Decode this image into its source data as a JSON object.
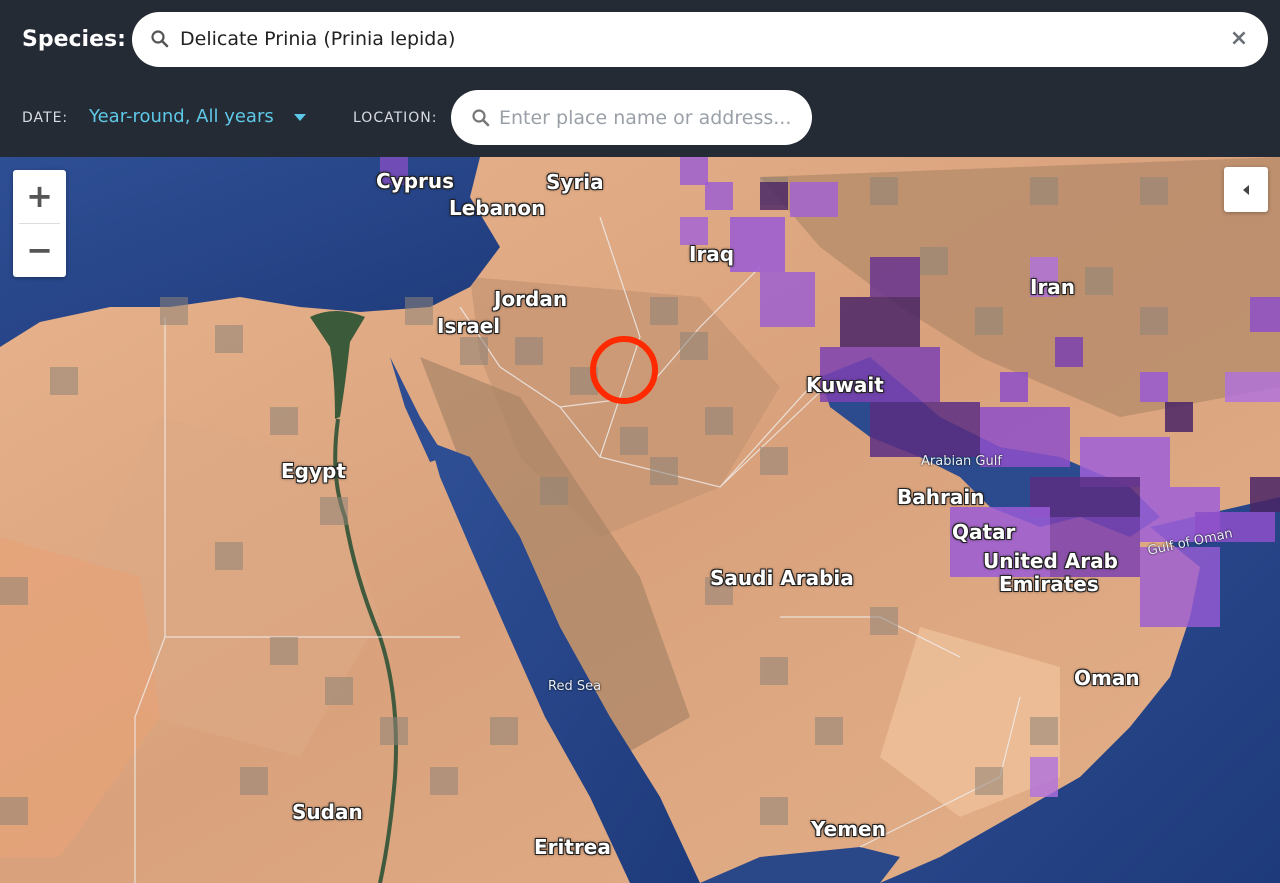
{
  "header": {
    "species_label": "Species:",
    "species_value": "Delicate Prinia (Prinia lepida)",
    "clear_glyph": "×",
    "date_label": "DATE:",
    "date_value": "Year-round,  All years",
    "location_label": "LOCATION:",
    "location_placeholder": "Enter place name or address..."
  },
  "map_controls": {
    "zoom_in": "+",
    "zoom_out": "−",
    "panel_toggle_icon": "chevron-left-icon"
  },
  "map_labels": {
    "cyprus": "Cyprus",
    "syria": "Syria",
    "lebanon": "Lebanon",
    "iraq": "Iraq",
    "iran": "Iran",
    "jordan": "Jordan",
    "israel": "Israel",
    "kuwait": "Kuwait",
    "egypt": "Egypt",
    "arabian_gulf": "Arabian Gulf",
    "bahrain": "Bahrain",
    "qatar": "Qatar",
    "uae_1": "United Arab",
    "uae_2": "Emirates",
    "gulf_of_oman": "Gulf of Oman",
    "saudi_arabia": "Saudi Arabia",
    "oman": "Oman",
    "red_sea": "Red Sea",
    "sudan": "Sudan",
    "yemen": "Yemen",
    "eritrea": "Eritrea"
  },
  "colors": {
    "header_bg": "#252b35",
    "accent": "#5ec8e8",
    "highlight_circle": "#ff2a00",
    "range_purple": "#8e4fc9",
    "range_dark_purple": "#4a2466"
  }
}
